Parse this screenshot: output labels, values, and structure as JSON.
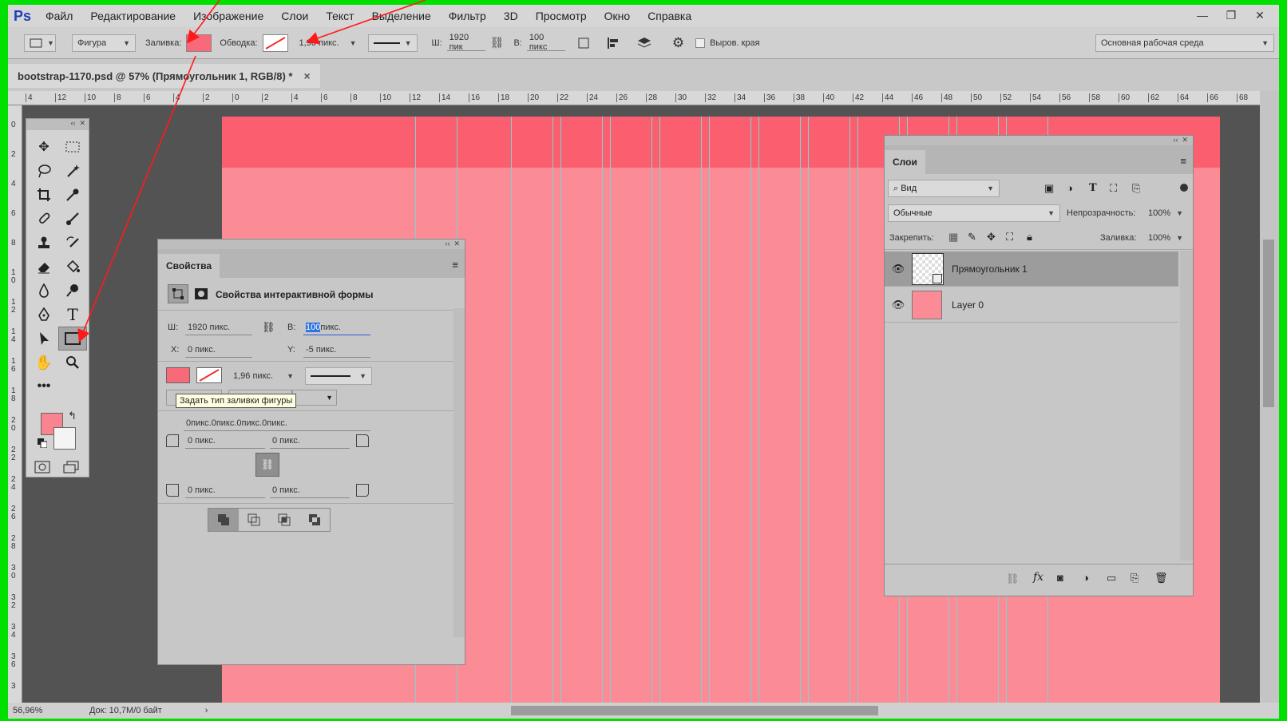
{
  "app": {
    "logo": "Ps"
  },
  "menu": [
    "Файл",
    "Редактирование",
    "Изображение",
    "Слои",
    "Текст",
    "Выделение",
    "Фильтр",
    "3D",
    "Просмотр",
    "Окно",
    "Справка"
  ],
  "window_controls": {
    "minimize": "—",
    "restore": "❐",
    "close": "✕"
  },
  "options": {
    "mode": "Фигура",
    "fill_label": "Заливка:",
    "stroke_label": "Обводка:",
    "stroke_width": "1,96 пикс.",
    "w_label": "Ш:",
    "w_value": "1920 пик",
    "h_label": "В:",
    "h_value": "100 пикс",
    "align_edges": "Выров. края",
    "workspace": "Основная рабочая среда",
    "fill_color": "#f8697a"
  },
  "document": {
    "tab_title": "bootstrap-1170.psd @ 57% (Прямоугольник 1, RGB/8) *",
    "close": "×"
  },
  "ruler": {
    "h": [
      "4",
      "12",
      "10",
      "8",
      "6",
      "4",
      "2",
      "0",
      "2",
      "4",
      "6",
      "8",
      "10",
      "12",
      "14",
      "16",
      "18",
      "20",
      "22",
      "24",
      "26",
      "28",
      "30",
      "32",
      "34",
      "36",
      "38",
      "40",
      "42",
      "44",
      "46",
      "48",
      "50",
      "52",
      "54",
      "56",
      "58",
      "60",
      "62",
      "64",
      "66",
      "68"
    ],
    "v": [
      "0",
      "2",
      "4",
      "6",
      "8",
      "1\n0",
      "1\n2",
      "1\n4",
      "1\n6",
      "1\n8",
      "2\n0",
      "2\n2",
      "2\n4",
      "2\n6",
      "2\n8",
      "3\n0",
      "3\n2",
      "3\n4",
      "3\n6",
      "3"
    ]
  },
  "properties": {
    "tab": "Свойства",
    "title": "Свойства интерактивной формы",
    "w_label": "Ш:",
    "w_value": "1920 пикс.",
    "h_label": "В:",
    "h_value_sel": "100",
    "h_value_rest": " пикс.",
    "x_label": "X:",
    "x_value": "0 пикс.",
    "y_label": "Y:",
    "y_value": "-5 пикс.",
    "stroke_width": "1,96 пикс.",
    "tooltip": "Задать тип заливки фигуры",
    "radii_summary": "0пикс.0пикс.0пикс.0пикс.",
    "r_tl": "0 пикс.",
    "r_tr": "0 пикс.",
    "r_bl": "0 пикс.",
    "r_br": "0 пикс."
  },
  "layers": {
    "tab": "Слои",
    "filter": "Вид",
    "blend": "Обычные",
    "opacity_label": "Непрозрачность:",
    "opacity_value": "100%",
    "lock_label": "Закрепить:",
    "fill_label": "Заливка:",
    "fill_value": "100%",
    "items": [
      {
        "name": "Прямоугольник 1",
        "selected": true
      },
      {
        "name": "Layer 0",
        "selected": false
      }
    ]
  },
  "status": {
    "zoom": "56,96%",
    "doc": "Док: 10,7M/0 байт"
  },
  "colors": {
    "canvas": "#fb8b95",
    "rect": "#fb5f6f",
    "guide": "#7fd3d3",
    "arrow": "#ff1a1a",
    "frame": "#00e000"
  }
}
